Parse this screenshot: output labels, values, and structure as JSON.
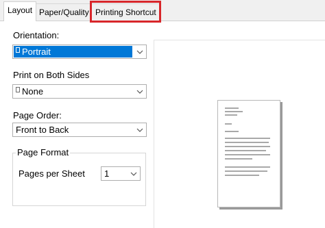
{
  "tabs": [
    {
      "label": "Layout",
      "active": true
    },
    {
      "label": "Paper/Quality",
      "active": false
    },
    {
      "label": "Printing Shortcut",
      "active": false,
      "highlighted": true
    }
  ],
  "orientation": {
    "label": "Orientation:",
    "value": "Portrait",
    "icon": "document-icon"
  },
  "print_both_sides": {
    "label": "Print on Both Sides",
    "value": "None",
    "icon": "document-icon"
  },
  "page_order": {
    "label": "Page Order:",
    "value": "Front to Back"
  },
  "page_format": {
    "title": "Page Format",
    "pages_per_sheet_label": "Pages per Sheet",
    "pages_per_sheet_value": "1"
  },
  "colors": {
    "selection": "#0078d7",
    "highlight_box": "#d8262a"
  }
}
